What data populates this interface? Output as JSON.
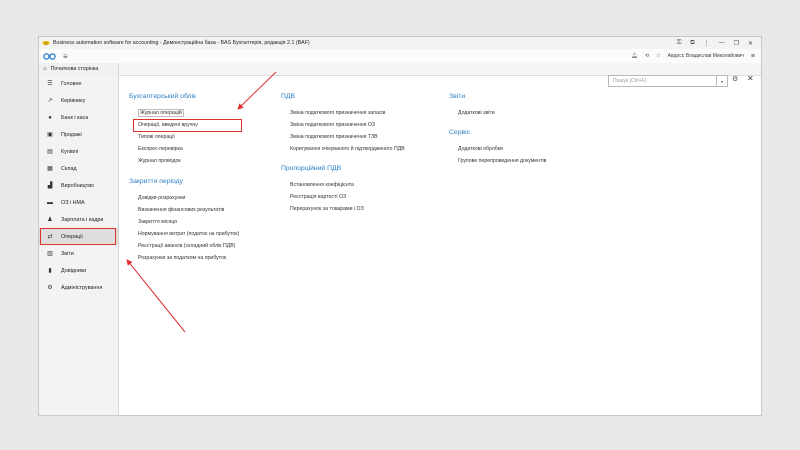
{
  "window": {
    "title": "Business automation software for accounting - Демонстраційна база - BAS Бухгалтерія, редакція 2.1 (BAF)",
    "user": "Авдосє Владислав Миколайович"
  },
  "home_tab": "Початкова сторінка",
  "sidebar": {
    "items": [
      {
        "label": "Головне",
        "icon": "menu-icon"
      },
      {
        "label": "Керівнику",
        "icon": "trend-icon"
      },
      {
        "label": "Банк і каса",
        "icon": "coin-icon"
      },
      {
        "label": "Продажі",
        "icon": "cart-icon"
      },
      {
        "label": "Купівлі",
        "icon": "basket-icon"
      },
      {
        "label": "Склад",
        "icon": "box-icon"
      },
      {
        "label": "Виробництво",
        "icon": "factory-icon"
      },
      {
        "label": "ОЗ і НМА",
        "icon": "truck-icon"
      },
      {
        "label": "Зарплата і кадри",
        "icon": "person-icon"
      },
      {
        "label": "Операції",
        "icon": "operations-icon"
      },
      {
        "label": "Звіти",
        "icon": "chart-icon"
      },
      {
        "label": "Довідники",
        "icon": "book-icon"
      },
      {
        "label": "Адміністрування",
        "icon": "gear-icon"
      }
    ],
    "active_index": 9
  },
  "search": {
    "placeholder": "Пошук (Ctrl+F)"
  },
  "sections": {
    "accounting": {
      "title": "Бухгалтерський облік",
      "links": [
        "Журнал операцій",
        "Операції, введені вручну",
        "Типові операції",
        "Експрес-перевірка",
        "Журнал проводок"
      ]
    },
    "closing": {
      "title": "Закриття періоду",
      "links": [
        "Довідки-розрахунки",
        "Визначення фінансових результатів",
        "Закриття місяця",
        "Нормування витрат (податок на прибуток)",
        "Реєстрації авансів (складний облік ПДВ)",
        "Розрахунки за податком на прибуток"
      ]
    },
    "vat": {
      "title": "ПДВ",
      "links": [
        "Зміна податкового призначення запасів",
        "Зміна податкового призначення ОЗ",
        "Зміна податкового призначення ТЗВ",
        "Коригування очікуваного й підтвердженого ПДВ"
      ]
    },
    "prop_vat": {
      "title": "Пропорційний ПДВ",
      "links": [
        "Встановлення коефіцієнта",
        "Реєстрація вартості ОЗ",
        "Перерахунок за товарами і ОЗ"
      ]
    },
    "reports": {
      "title": "Звіти",
      "links": [
        "Додаткові звіти"
      ]
    },
    "service": {
      "title": "Сервіс",
      "links": [
        "Додаткові обробки",
        "Групове перепроведення документів"
      ]
    }
  },
  "annotation_color": "#e03030",
  "accent_color": "#2a7ec4"
}
